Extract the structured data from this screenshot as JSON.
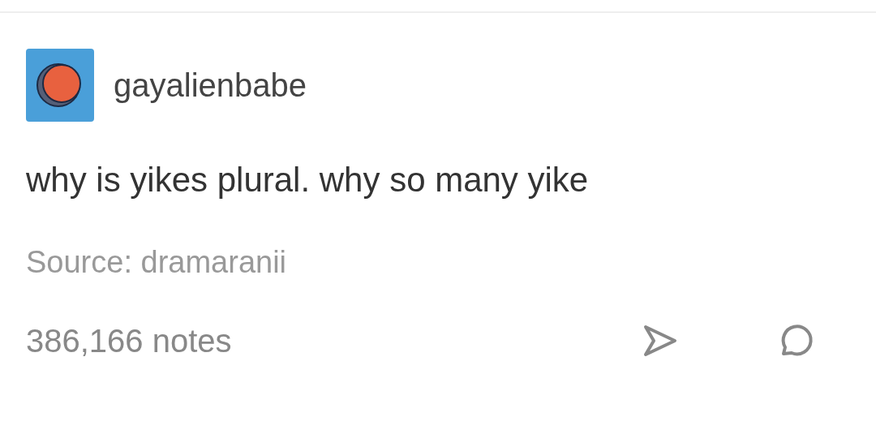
{
  "post": {
    "username": "gayalienbabe",
    "body": "why is yikes plural. why so many yike",
    "source_label": "Source:",
    "source_name": "dramaranii",
    "notes": "386,166 notes"
  }
}
